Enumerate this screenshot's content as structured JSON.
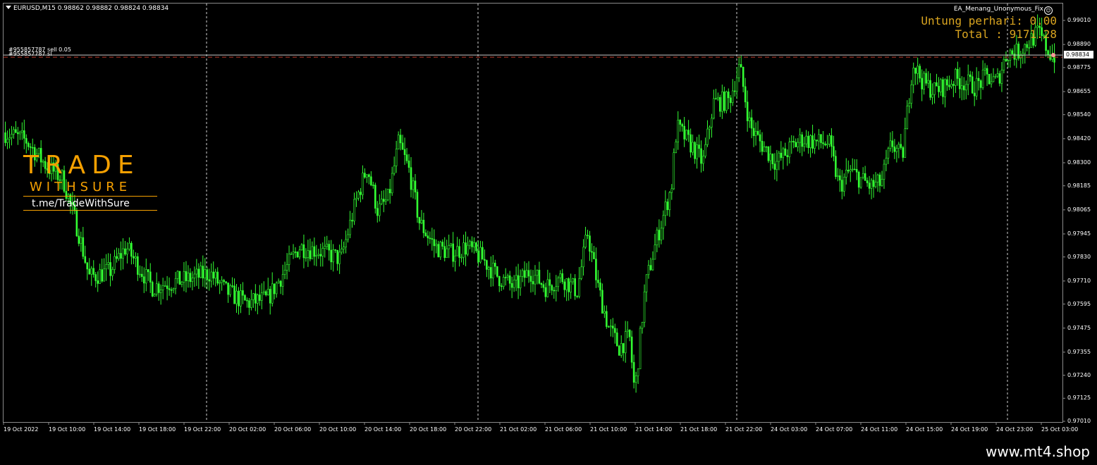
{
  "window": {
    "symbol_header": "EURUSD,M15  0.98862 0.98882 0.98824 0.98834"
  },
  "indicator": {
    "ea_name": "EA_Menang_Unonymous_Fix",
    "ea_icon": "smiley-icon",
    "profit_lines": [
      "Untung perhari: 0.00",
      "   Total : 9171.28"
    ],
    "profit_color": "#daa520"
  },
  "order": {
    "label": "#955857787 sell 0.05",
    "label_overlap": "#955857787 sl",
    "line_color": "#c0392b"
  },
  "price_tag": "0.98834",
  "watermark": {
    "title": "TRADE",
    "subtitle": "WITHSURE",
    "link": "t.me/TradeWithSure",
    "color": "#f5a000"
  },
  "footer": {
    "site": "www.mt4.shop"
  },
  "chart_data": {
    "type": "line",
    "style": "candlestick",
    "symbol": "EURUSD",
    "timeframe": "M15",
    "candle_color": "#33ff33",
    "y_ticks": [
      "0.99010",
      "0.98890",
      "0.98775",
      "0.98655",
      "0.98540",
      "0.98420",
      "0.98300",
      "0.98185",
      "0.98065",
      "0.97945",
      "0.97830",
      "0.97710",
      "0.97595",
      "0.97475",
      "0.97355",
      "0.97240",
      "0.97125",
      "0.97010"
    ],
    "ylim": [
      0.9701,
      0.9901
    ],
    "x_ticks": [
      "19 Oct 2022",
      "19 Oct 10:00",
      "19 Oct 14:00",
      "19 Oct 18:00",
      "19 Oct 22:00",
      "20 Oct 02:00",
      "20 Oct 06:00",
      "20 Oct 10:00",
      "20 Oct 14:00",
      "20 Oct 18:00",
      "20 Oct 22:00",
      "21 Oct 02:00",
      "21 Oct 06:00",
      "21 Oct 10:00",
      "21 Oct 14:00",
      "21 Oct 18:00",
      "21 Oct 22:00",
      "24 Oct 03:00",
      "24 Oct 07:00",
      "24 Oct 11:00",
      "24 Oct 15:00",
      "24 Oct 19:00",
      "24 Oct 23:00",
      "25 Oct 03:00"
    ],
    "day_separators": [
      "19 Oct 22:00",
      "20 Oct 22:00",
      "21 Oct 22:00",
      "24 Oct 23:00"
    ],
    "current_price": 0.98834,
    "close_path": [
      [
        0,
        0.9845
      ],
      [
        0.02,
        0.9841
      ],
      [
        0.04,
        0.9828
      ],
      [
        0.055,
        0.9822
      ],
      [
        0.07,
        0.9795
      ],
      [
        0.08,
        0.9773
      ],
      [
        0.1,
        0.9776
      ],
      [
        0.115,
        0.9788
      ],
      [
        0.125,
        0.978
      ],
      [
        0.14,
        0.9768
      ],
      [
        0.155,
        0.977
      ],
      [
        0.175,
        0.9772
      ],
      [
        0.195,
        0.9775
      ],
      [
        0.21,
        0.9766
      ],
      [
        0.23,
        0.976
      ],
      [
        0.25,
        0.9762
      ],
      [
        0.265,
        0.9775
      ],
      [
        0.28,
        0.9788
      ],
      [
        0.3,
        0.9786
      ],
      [
        0.32,
        0.9782
      ],
      [
        0.335,
        0.9812
      ],
      [
        0.345,
        0.9828
      ],
      [
        0.355,
        0.9806
      ],
      [
        0.365,
        0.9812
      ],
      [
        0.375,
        0.984
      ],
      [
        0.385,
        0.9826
      ],
      [
        0.395,
        0.98
      ],
      [
        0.41,
        0.9788
      ],
      [
        0.425,
        0.9785
      ],
      [
        0.44,
        0.9788
      ],
      [
        0.455,
        0.9782
      ],
      [
        0.47,
        0.9773
      ],
      [
        0.485,
        0.9768
      ],
      [
        0.5,
        0.9776
      ],
      [
        0.515,
        0.9768
      ],
      [
        0.53,
        0.9773
      ],
      [
        0.545,
        0.9766
      ],
      [
        0.555,
        0.9795
      ],
      [
        0.565,
        0.9768
      ],
      [
        0.575,
        0.9748
      ],
      [
        0.585,
        0.9738
      ],
      [
        0.595,
        0.9743
      ],
      [
        0.6,
        0.9715
      ],
      [
        0.61,
        0.9768
      ],
      [
        0.62,
        0.979
      ],
      [
        0.635,
        0.9818
      ],
      [
        0.64,
        0.9848
      ],
      [
        0.655,
        0.9838
      ],
      [
        0.665,
        0.983
      ],
      [
        0.675,
        0.986
      ],
      [
        0.69,
        0.9861
      ],
      [
        0.7,
        0.9878
      ],
      [
        0.71,
        0.9848
      ],
      [
        0.72,
        0.984
      ],
      [
        0.735,
        0.983
      ],
      [
        0.75,
        0.9838
      ],
      [
        0.76,
        0.9842
      ],
      [
        0.775,
        0.984
      ],
      [
        0.785,
        0.984
      ],
      [
        0.795,
        0.9818
      ],
      [
        0.805,
        0.9826
      ],
      [
        0.815,
        0.9822
      ],
      [
        0.825,
        0.9818
      ],
      [
        0.835,
        0.982
      ],
      [
        0.845,
        0.984
      ],
      [
        0.855,
        0.9832
      ],
      [
        0.865,
        0.988
      ],
      [
        0.875,
        0.987
      ],
      [
        0.885,
        0.9866
      ],
      [
        0.895,
        0.9868
      ],
      [
        0.905,
        0.9872
      ],
      [
        0.915,
        0.987
      ],
      [
        0.925,
        0.9868
      ],
      [
        0.935,
        0.9873
      ],
      [
        0.945,
        0.987
      ],
      [
        0.955,
        0.9885
      ],
      [
        0.965,
        0.9885
      ],
      [
        0.975,
        0.989
      ],
      [
        0.985,
        0.9895
      ],
      [
        0.995,
        0.9885
      ],
      [
        1,
        0.98834
      ]
    ]
  }
}
